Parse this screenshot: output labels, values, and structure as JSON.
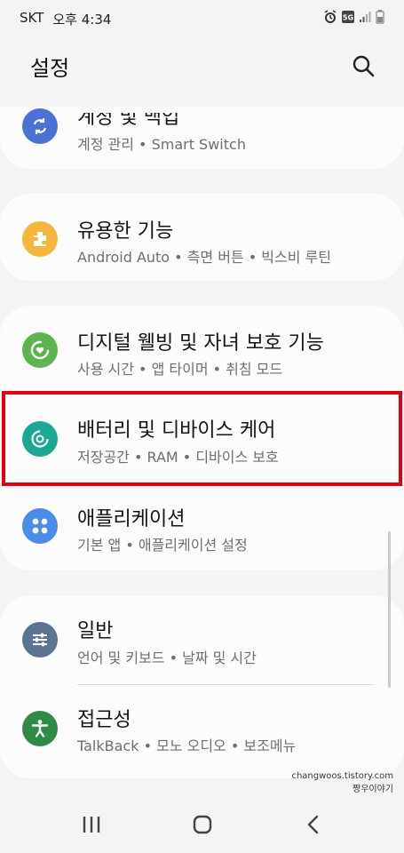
{
  "status_bar": {
    "carrier": "SKT",
    "time": "오후 4:34",
    "icons": [
      "alarm-icon",
      "5g-icon",
      "signal-icon",
      "battery-icon"
    ],
    "network_label": "5G"
  },
  "header": {
    "title": "설정",
    "search_icon": "search-icon"
  },
  "settings": [
    {
      "title": "계정 및 백업",
      "subtitle": "계정 관리 • Smart Switch",
      "icon": "sync-icon",
      "color": "#4a72d4"
    },
    {
      "title": "유용한 기능",
      "subtitle": "Android Auto • 측면 버튼 • 빅스비 루틴",
      "icon": "puzzle-icon",
      "color": "#f6b63d"
    },
    {
      "title": "디지털 웰빙 및 자녀 보호 기능",
      "subtitle": "사용 시간 • 앱 타이머 • 취침 모드",
      "icon": "wellbeing-icon",
      "color": "#5fb34f"
    },
    {
      "title": "배터리 및 디바이스 케어",
      "subtitle": "저장공간 • RAM • 디바이스 보호",
      "icon": "device-care-icon",
      "color": "#1aa894"
    },
    {
      "title": "애플리케이션",
      "subtitle": "기본 앱 • 애플리케이션 설정",
      "icon": "apps-icon",
      "color": "#4c8be8"
    },
    {
      "title": "일반",
      "subtitle": "언어 및 키보드 • 날짜 및 시간",
      "icon": "sliders-icon",
      "color": "#5a7491"
    },
    {
      "title": "접근성",
      "subtitle": "TalkBack • 모노 오디오 • 보조메뉴",
      "icon": "accessibility-icon",
      "color": "#2f8a45"
    }
  ],
  "highlight_color": "#e1000f",
  "watermark": {
    "line1": "changwoos.tistory.com",
    "line2": "짱우이야기"
  },
  "nav": {
    "recents_icon": "recents-icon",
    "home_icon": "home-icon",
    "back_icon": "back-icon"
  }
}
